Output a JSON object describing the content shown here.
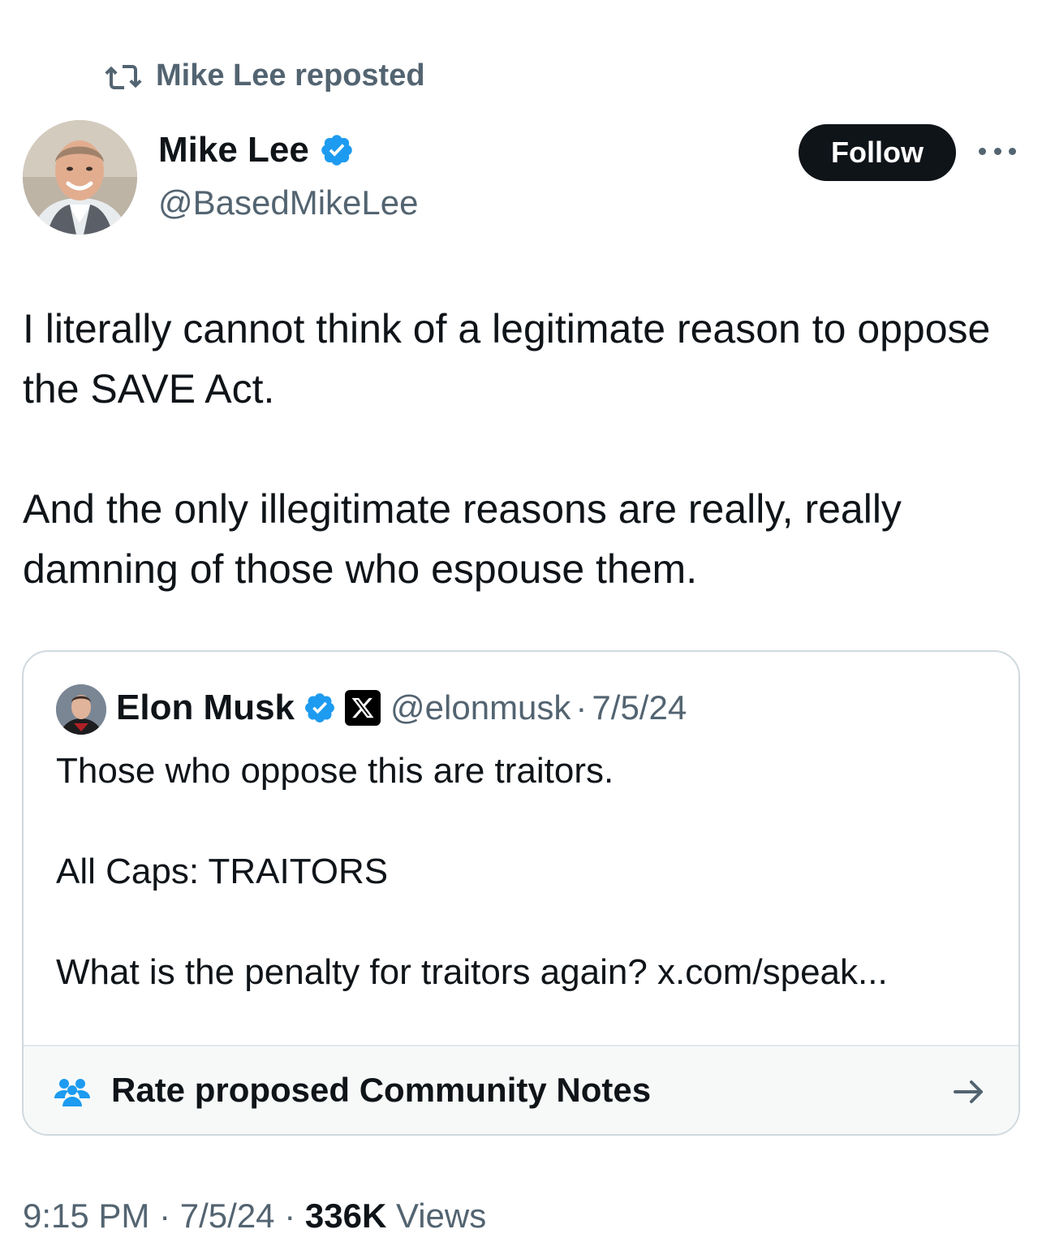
{
  "repost": {
    "label": "Mike Lee reposted",
    "icon": "repost-icon"
  },
  "author": {
    "name": "Mike Lee",
    "handle": "@BasedMikeLee",
    "verified": true,
    "badge_color": "#1d9bf0"
  },
  "actions": {
    "follow_label": "Follow",
    "more_icon": "more-horizontal-icon"
  },
  "tweet": {
    "paragraphs": [
      "I literally cannot think of a legitimate reason to oppose the SAVE Act.",
      "And the only illegitimate reasons are really, really damning of those who espouse them."
    ]
  },
  "quote": {
    "name": "Elon Musk",
    "verified": true,
    "affiliation_badge": "X",
    "handle": "@elonmusk",
    "separator": "·",
    "date": "7/5/24",
    "paragraphs": [
      "Those who oppose this are traitors.",
      "All Caps: TRAITORS",
      "What is the penalty for traitors again? x.com/speak..."
    ],
    "community_notes": {
      "label": "Rate proposed Community Notes",
      "icon": "people-icon",
      "icon_color": "#1d9bf0",
      "arrow": "arrow-right-icon"
    }
  },
  "meta": {
    "time": "9:15 PM",
    "sep1": "·",
    "date": "7/5/24",
    "sep2": "·",
    "views_count": "336K",
    "views_label": "Views"
  },
  "colors": {
    "text": "#0f1419",
    "muted": "#536471",
    "accent": "#1d9bf0",
    "border": "#cfd9de"
  }
}
